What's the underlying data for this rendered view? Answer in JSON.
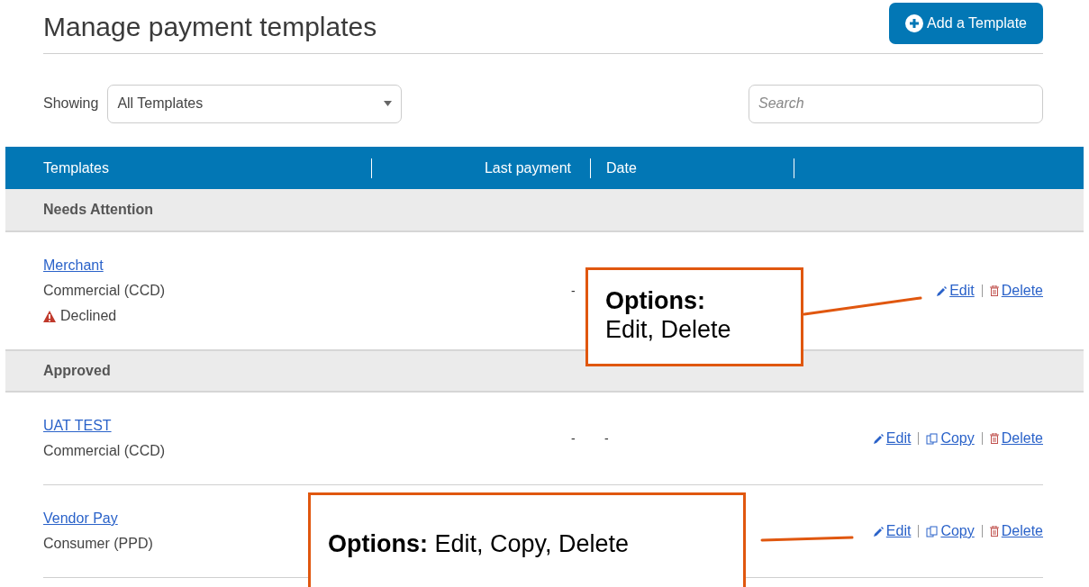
{
  "page_title": "Manage payment templates",
  "add_button": "Add a Template",
  "filter": {
    "label": "Showing",
    "value": "All Templates"
  },
  "search": {
    "placeholder": "Search"
  },
  "table": {
    "columns": [
      "Templates",
      "Last payment",
      "Date"
    ],
    "sections": [
      {
        "title": "Needs Attention",
        "rows": [
          {
            "name": "Merchant",
            "type": "Commercial (CCD)",
            "status": "Declined",
            "last_payment": "-",
            "actions": [
              {
                "kind": "edit",
                "label": "Edit"
              },
              {
                "kind": "delete",
                "label": "Delete"
              }
            ]
          }
        ]
      },
      {
        "title": "Approved",
        "rows": [
          {
            "name": "UAT TEST",
            "type": "Commercial (CCD)",
            "last_payment": "-",
            "date": "-",
            "actions": [
              {
                "kind": "edit",
                "label": "Edit"
              },
              {
                "kind": "copy",
                "label": "Copy"
              },
              {
                "kind": "delete",
                "label": "Delete"
              }
            ]
          },
          {
            "name": "Vendor Pay",
            "type": "Consumer (PPD)",
            "actions": [
              {
                "kind": "edit",
                "label": "Edit"
              },
              {
                "kind": "copy",
                "label": "Copy"
              },
              {
                "kind": "delete",
                "label": "Delete"
              }
            ]
          }
        ]
      }
    ]
  },
  "callouts": [
    {
      "text": "**Options:**\nEdit, Delete"
    },
    {
      "text": "**Options:** Edit, Copy, Delete"
    }
  ]
}
